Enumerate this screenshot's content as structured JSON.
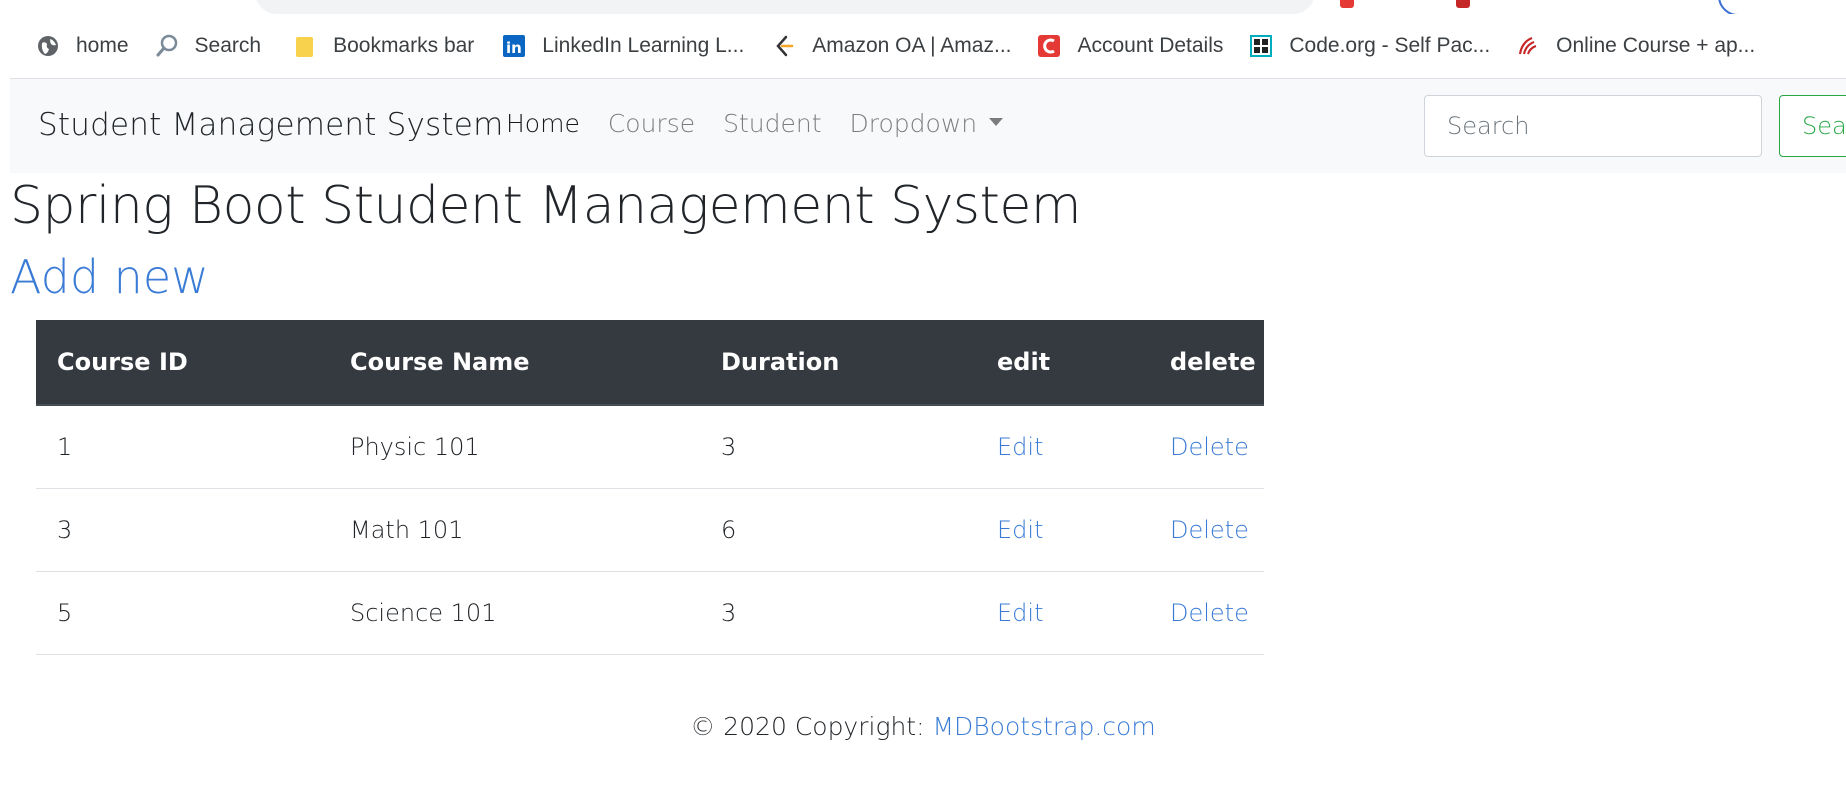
{
  "bookmarks": [
    {
      "icon": "globe-icon",
      "label": "home"
    },
    {
      "icon": "search-icon",
      "label": "Search"
    },
    {
      "icon": "folder-icon",
      "label": "Bookmarks bar"
    },
    {
      "icon": "linkedin-icon",
      "label": "LinkedIn Learning L..."
    },
    {
      "icon": "leetcode-icon",
      "label": "Amazon OA | Amaz..."
    },
    {
      "icon": "coursera-icon",
      "label": "Account Details"
    },
    {
      "icon": "codeorg-icon",
      "label": "Code.org - Self Pac..."
    },
    {
      "icon": "course-icon",
      "label": "Online Course + ap..."
    }
  ],
  "navbar": {
    "brand": "Student Management System",
    "links": [
      "Home",
      "Course",
      "Student",
      "Dropdown"
    ],
    "search_placeholder": "Search",
    "search_button": "Search"
  },
  "page": {
    "title": "Spring Boot Student Management System",
    "add_new": "Add new"
  },
  "table": {
    "headers": [
      "Course ID",
      "Course Name",
      "Duration",
      "edit",
      "delete"
    ],
    "rows": [
      {
        "id": "1",
        "name": "Physic 101",
        "duration": "3",
        "edit": "Edit",
        "delete": "Delete"
      },
      {
        "id": "3",
        "name": "Math 101",
        "duration": "6",
        "edit": "Edit",
        "delete": "Delete"
      },
      {
        "id": "5",
        "name": "Science 101",
        "duration": "3",
        "edit": "Edit",
        "delete": "Delete"
      }
    ]
  },
  "footer": {
    "text": "© 2020 Copyright: ",
    "link": "MDBootstrap.com"
  },
  "colors": {
    "link": "#3a7bd5",
    "table_header": "#343a40",
    "search_button": "#28a745",
    "navbar_bg": "#f8f9fa"
  }
}
